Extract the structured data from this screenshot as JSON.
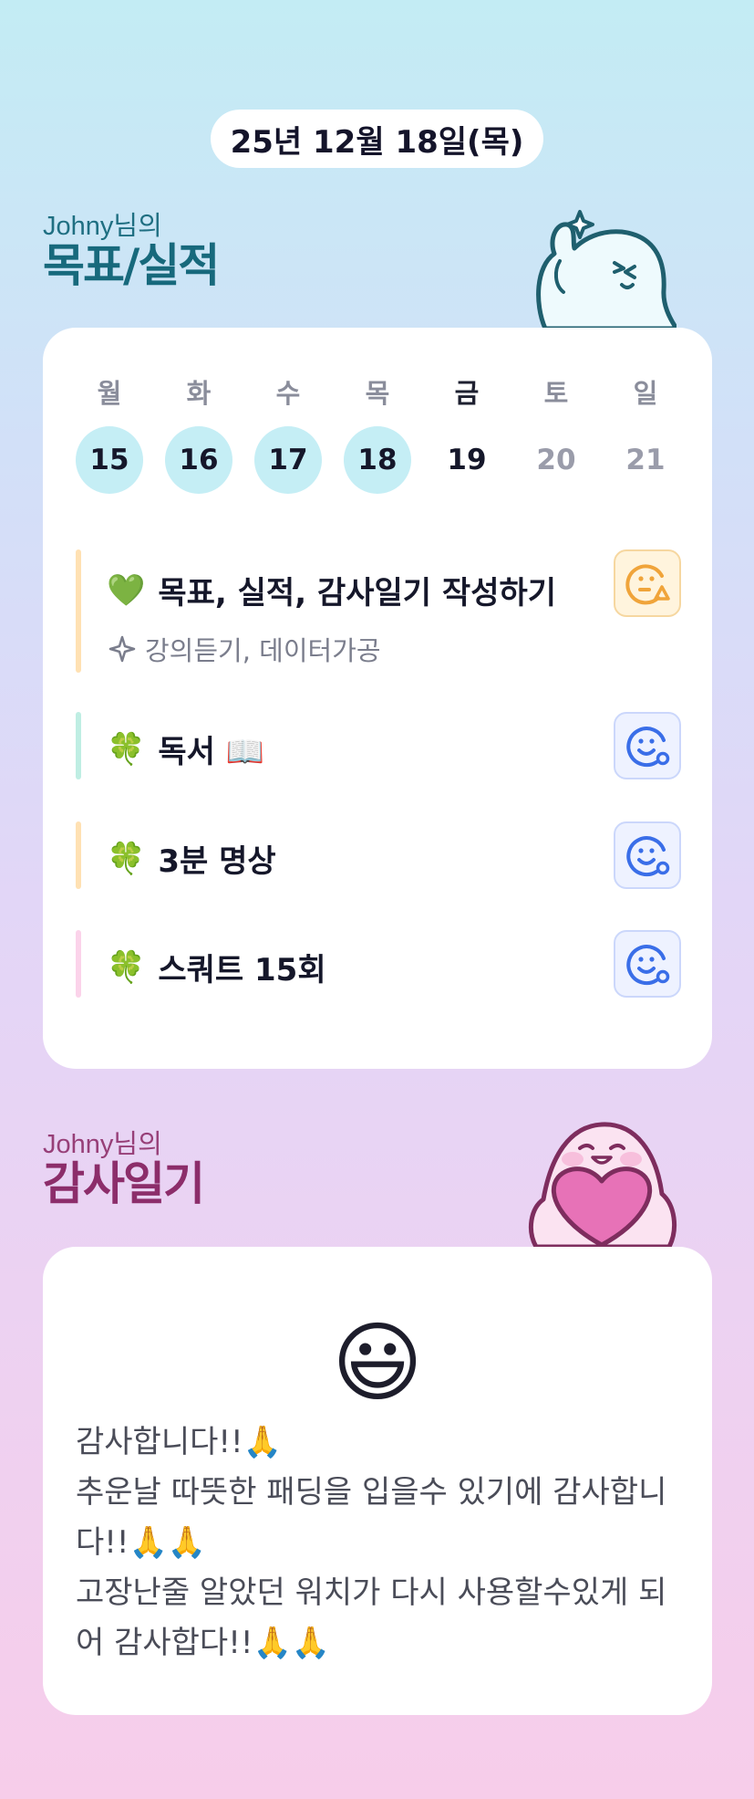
{
  "header": {
    "date": "25년 12월 18일(목)"
  },
  "goal_section": {
    "user_label": "Johny님의",
    "title": "목표/실적",
    "character_icon": "waving-ghost-character"
  },
  "week": {
    "days": [
      {
        "name": "월",
        "num": "15",
        "state": "done"
      },
      {
        "name": "화",
        "num": "16",
        "state": "done"
      },
      {
        "name": "수",
        "num": "17",
        "state": "done"
      },
      {
        "name": "목",
        "num": "18",
        "state": "done"
      },
      {
        "name": "금",
        "num": "19",
        "state": "today"
      },
      {
        "name": "토",
        "num": "20",
        "state": "future"
      },
      {
        "name": "일",
        "num": "21",
        "state": "future"
      }
    ]
  },
  "goals": [
    {
      "emoji": "💚",
      "title": "목표, 실적, 감사일기 작성하기",
      "sub_icon": "sparkle-outline-icon",
      "sub": "강의듣기, 데이터가공",
      "bar_color": "#ffe1b3",
      "mood": "warning-face-icon"
    },
    {
      "emoji": "🍀",
      "title": "독서 📖",
      "bar_color": "#bfeee3",
      "mood": "smile-face-icon"
    },
    {
      "emoji": "🍀",
      "title": "3분 명상",
      "bar_color": "#ffe1b3",
      "mood": "smile-face-icon"
    },
    {
      "emoji": "🍀",
      "title": "스쿼트 15회",
      "bar_color": "#fbd3ea",
      "mood": "smile-face-icon"
    }
  ],
  "diary_section": {
    "user_label": "Johny님의",
    "title": "감사일기",
    "character_icon": "pink-heart-character"
  },
  "diary": {
    "mood_emoji": "😃",
    "text": "감사합니다!!🙏\n추운날 따뜻한 패딩을 입을수 있기에 감사합니다!!🙏🙏\n고장난줄 알았던 워치가 다시 사용할수있게 되어 감사합다!!🙏🙏"
  },
  "colors": {
    "done_circle": "#c5eef5",
    "goal_title_color": "#17697c",
    "diary_title_color": "#8c2d6a",
    "mood_warn": "#f0a43a",
    "mood_ok": "#3a6ee8"
  }
}
